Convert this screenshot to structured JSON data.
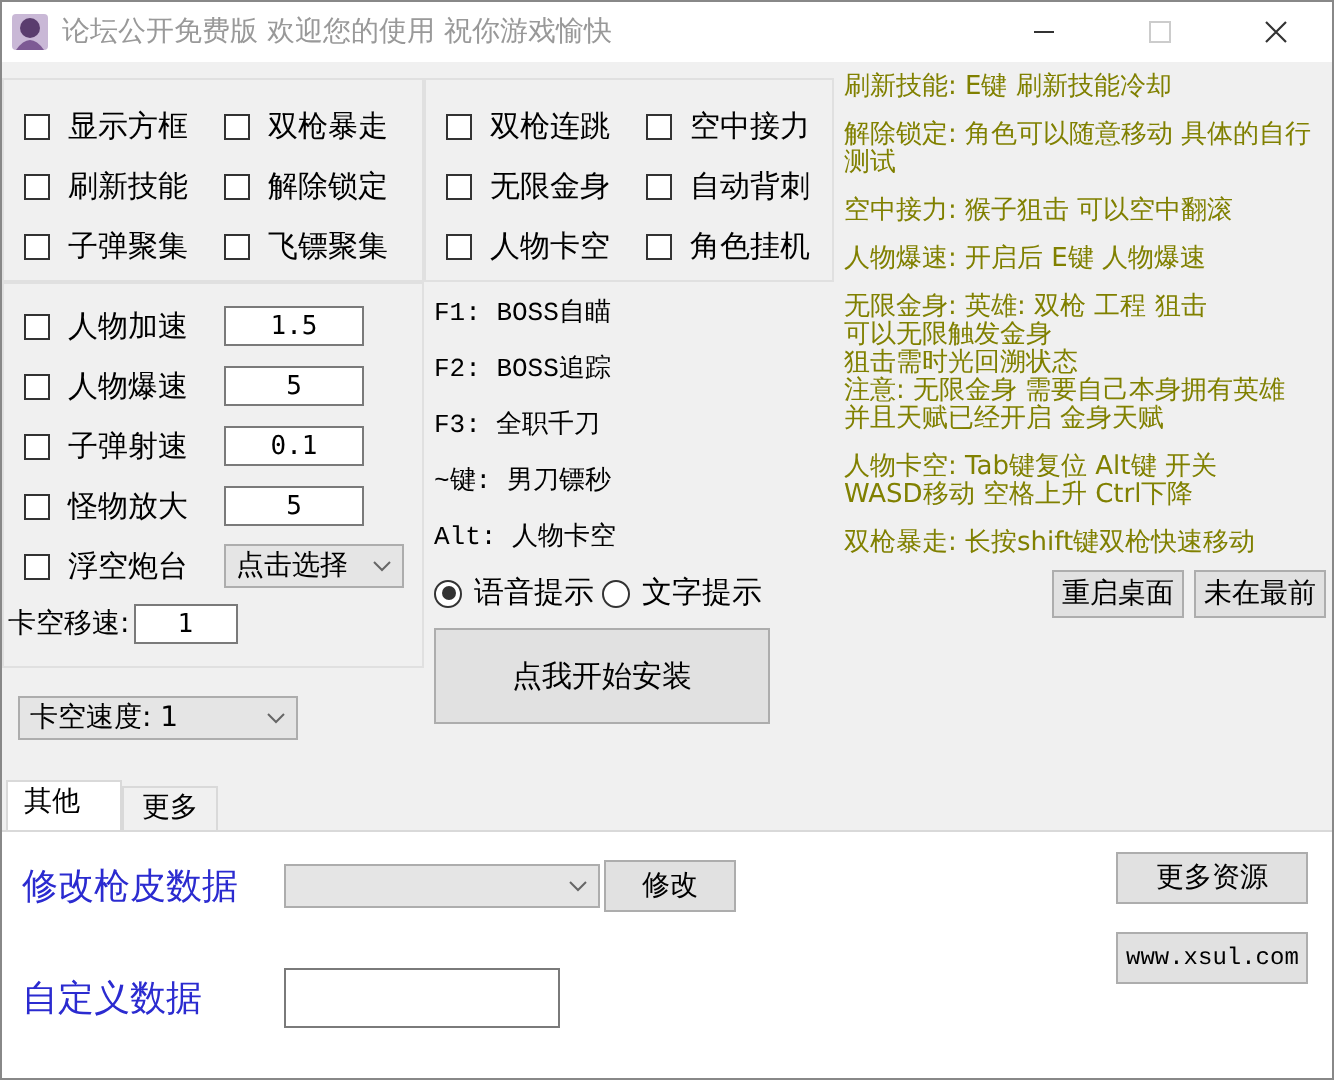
{
  "window": {
    "title": "论坛公开免费版 欢迎您的使用 祝你游戏愉快"
  },
  "option_groups": [
    {
      "options": [
        {
          "label": "显示方框",
          "checked": false
        },
        {
          "label": "双枪暴走",
          "checked": false
        },
        {
          "label": "刷新技能",
          "checked": false
        },
        {
          "label": "解除锁定",
          "checked": false
        },
        {
          "label": "子弹聚集",
          "checked": false
        },
        {
          "label": "飞镖聚集",
          "checked": false
        }
      ]
    },
    {
      "options": [
        {
          "label": "双枪连跳",
          "checked": false
        },
        {
          "label": "空中接力",
          "checked": false
        },
        {
          "label": "无限金身",
          "checked": false
        },
        {
          "label": "自动背刺",
          "checked": false
        },
        {
          "label": "人物卡空",
          "checked": false
        },
        {
          "label": "角色挂机",
          "checked": false
        }
      ]
    }
  ],
  "speed_settings": [
    {
      "kind": "input",
      "label": "人物加速",
      "checked": false,
      "value": "1.5"
    },
    {
      "kind": "input",
      "label": "人物爆速",
      "checked": false,
      "value": "5"
    },
    {
      "kind": "input",
      "label": "子弹射速",
      "checked": false,
      "value": "0.1"
    },
    {
      "kind": "input",
      "label": "怪物放大",
      "checked": false,
      "value": "5"
    },
    {
      "kind": "select",
      "label": "浮空炮台",
      "checked": false,
      "value": "点击选择"
    }
  ],
  "move_speed": {
    "label": "卡空移速:",
    "value": "1"
  },
  "speed_select": {
    "value": "卡空速度: 1"
  },
  "hotkeys": [
    "F1: BOSS自瞄",
    "F2: BOSS追踪",
    "F3: 全职千刀",
    "~键: 男刀镖秒",
    "Alt: 人物卡空"
  ],
  "prompts": [
    {
      "label": "语音提示",
      "selected": true
    },
    {
      "label": "文字提示",
      "selected": false
    }
  ],
  "install_button": "点我开始安装",
  "notes": [
    {
      "lines": [
        "刷新技能: E键 刷新技能冷却"
      ]
    },
    {
      "lines": [
        "解除锁定: 角色可以随意移动 具体的自行测试"
      ]
    },
    {
      "lines": [
        "空中接力: 猴子狙击 可以空中翻滚"
      ]
    },
    {
      "lines": [
        "人物爆速: 开启后 E键 人物爆速"
      ]
    },
    {
      "lines": [
        "无限金身: 英雄: 双枪 工程 狙击",
        "可以无限触发金身",
        "狙击需时光回溯状态",
        "注意: 无限金身 需要自己本身拥有英雄",
        "并且天赋已经开启 金身天赋"
      ]
    },
    {
      "lines": [
        "人物卡空:  Tab键复位 Alt键 开关",
        "WASD移动 空格上升 Ctrl下降"
      ]
    },
    {
      "lines": [
        "双枪暴走: 长按shift键双枪快速移动"
      ]
    }
  ],
  "side_buttons": [
    "重启桌面",
    "未在最前"
  ],
  "tabs": [
    {
      "label": "其他",
      "selected": true
    },
    {
      "label": "更多",
      "selected": false
    }
  ],
  "tab_panel": {
    "skin": {
      "label": "修改枪皮数据",
      "button": "修改"
    },
    "custom": {
      "label": "自定义数据"
    },
    "links": [
      "更多资源",
      "www.xsul.com"
    ]
  }
}
